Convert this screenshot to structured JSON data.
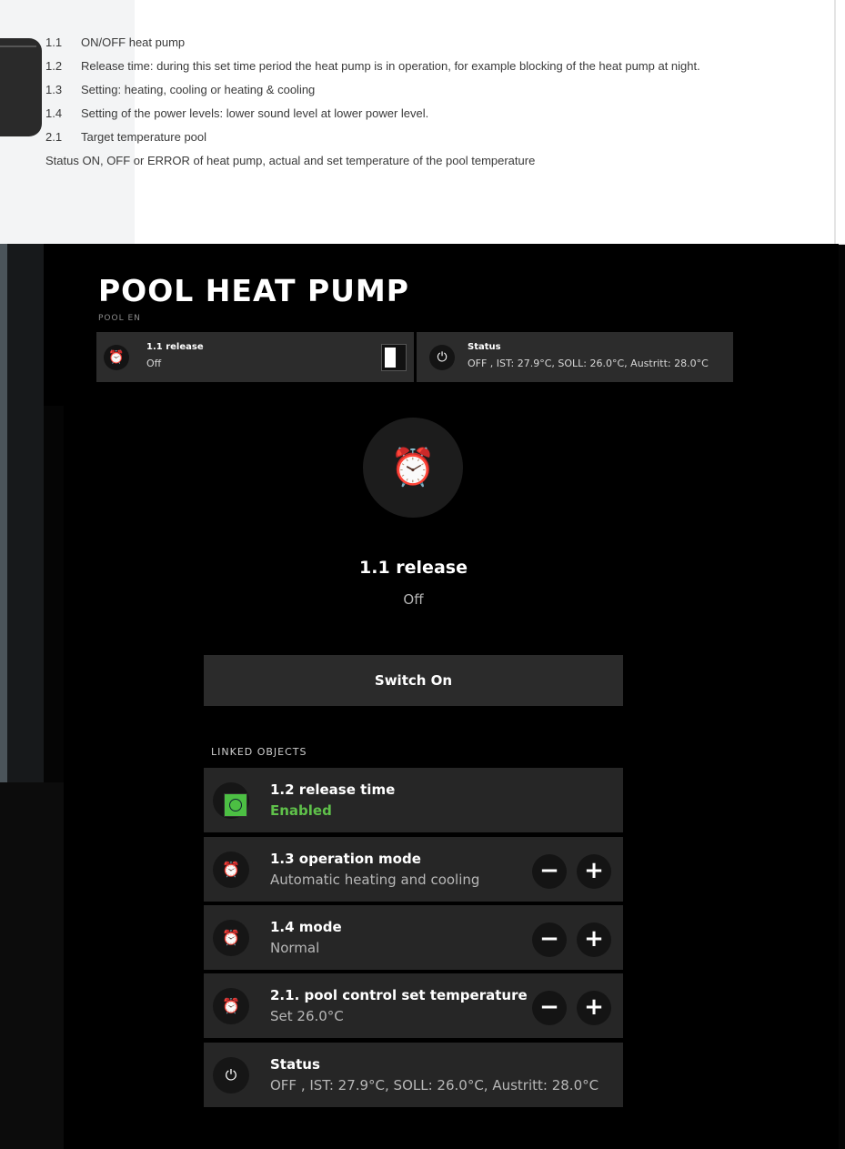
{
  "doc": {
    "items": [
      {
        "num": "1.1",
        "text": "ON/OFF heat pump"
      },
      {
        "num": "1.2",
        "text": "Release time: during this set time period the heat pump is in operation, for example blocking of the heat pump at night."
      },
      {
        "num": "1.3",
        "text": "Setting: heating, cooling or heating & cooling"
      },
      {
        "num": "1.4",
        "text": "Setting of the power levels: lower sound level at lower power level."
      },
      {
        "num": "2.1",
        "text": "Target temperature pool"
      }
    ],
    "status_note": "Status ON, OFF or ERROR of heat pump, actual and set temperature of the pool temperature"
  },
  "header": {
    "title": "POOL HEAT PUMP",
    "subtitle": "POOL EN",
    "tiles": [
      {
        "title": "1.1 release",
        "value": "Off",
        "icon": "alarm-fire-icon"
      },
      {
        "title": "Status",
        "value": "OFF , IST: 27.9°C, SOLL: 26.0°C, Austritt: 28.0°C",
        "icon": "power-icon"
      }
    ]
  },
  "detail": {
    "title": "1.1 release",
    "state": "Off",
    "switch_label": "Switch On",
    "linked_label": "LINKED OBJECTS"
  },
  "linked": [
    {
      "title": "1.2 release time",
      "value": "Enabled",
      "icon": "clock-icon"
    },
    {
      "title": "1.3 operation mode",
      "value": "Automatic heating and cooling",
      "icon": "alarm-fire-icon"
    },
    {
      "title": "1.4 mode",
      "value": "Normal",
      "icon": "alarm-fire-icon"
    },
    {
      "title": "2.1. pool control set temperature",
      "value": "Set 26.0°C",
      "icon": "alarm-fire-icon"
    },
    {
      "title": "Status",
      "value": "OFF , IST: 27.9°C, SOLL: 26.0°C, Austritt: 28.0°C",
      "icon": "power-icon"
    }
  ],
  "controls": {
    "minus": "−",
    "plus": "+"
  },
  "colors": {
    "enabled_green": "#5fc14a",
    "tile_bg": "#2c2c2c",
    "panel_bg": "#000000"
  }
}
